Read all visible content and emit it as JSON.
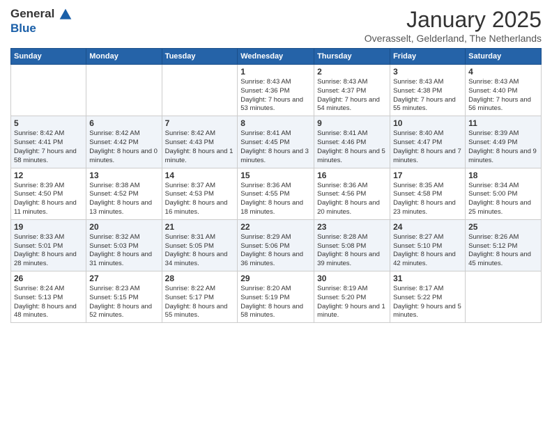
{
  "header": {
    "logo_general": "General",
    "logo_blue": "Blue",
    "month_title": "January 2025",
    "location": "Overasselt, Gelderland, The Netherlands"
  },
  "days_of_week": [
    "Sunday",
    "Monday",
    "Tuesday",
    "Wednesday",
    "Thursday",
    "Friday",
    "Saturday"
  ],
  "weeks": [
    [
      {
        "day": "",
        "info": ""
      },
      {
        "day": "",
        "info": ""
      },
      {
        "day": "",
        "info": ""
      },
      {
        "day": "1",
        "info": "Sunrise: 8:43 AM\nSunset: 4:36 PM\nDaylight: 7 hours and 53 minutes."
      },
      {
        "day": "2",
        "info": "Sunrise: 8:43 AM\nSunset: 4:37 PM\nDaylight: 7 hours and 54 minutes."
      },
      {
        "day": "3",
        "info": "Sunrise: 8:43 AM\nSunset: 4:38 PM\nDaylight: 7 hours and 55 minutes."
      },
      {
        "day": "4",
        "info": "Sunrise: 8:43 AM\nSunset: 4:40 PM\nDaylight: 7 hours and 56 minutes."
      }
    ],
    [
      {
        "day": "5",
        "info": "Sunrise: 8:42 AM\nSunset: 4:41 PM\nDaylight: 7 hours and 58 minutes."
      },
      {
        "day": "6",
        "info": "Sunrise: 8:42 AM\nSunset: 4:42 PM\nDaylight: 8 hours and 0 minutes."
      },
      {
        "day": "7",
        "info": "Sunrise: 8:42 AM\nSunset: 4:43 PM\nDaylight: 8 hours and 1 minute."
      },
      {
        "day": "8",
        "info": "Sunrise: 8:41 AM\nSunset: 4:45 PM\nDaylight: 8 hours and 3 minutes."
      },
      {
        "day": "9",
        "info": "Sunrise: 8:41 AM\nSunset: 4:46 PM\nDaylight: 8 hours and 5 minutes."
      },
      {
        "day": "10",
        "info": "Sunrise: 8:40 AM\nSunset: 4:47 PM\nDaylight: 8 hours and 7 minutes."
      },
      {
        "day": "11",
        "info": "Sunrise: 8:39 AM\nSunset: 4:49 PM\nDaylight: 8 hours and 9 minutes."
      }
    ],
    [
      {
        "day": "12",
        "info": "Sunrise: 8:39 AM\nSunset: 4:50 PM\nDaylight: 8 hours and 11 minutes."
      },
      {
        "day": "13",
        "info": "Sunrise: 8:38 AM\nSunset: 4:52 PM\nDaylight: 8 hours and 13 minutes."
      },
      {
        "day": "14",
        "info": "Sunrise: 8:37 AM\nSunset: 4:53 PM\nDaylight: 8 hours and 16 minutes."
      },
      {
        "day": "15",
        "info": "Sunrise: 8:36 AM\nSunset: 4:55 PM\nDaylight: 8 hours and 18 minutes."
      },
      {
        "day": "16",
        "info": "Sunrise: 8:36 AM\nSunset: 4:56 PM\nDaylight: 8 hours and 20 minutes."
      },
      {
        "day": "17",
        "info": "Sunrise: 8:35 AM\nSunset: 4:58 PM\nDaylight: 8 hours and 23 minutes."
      },
      {
        "day": "18",
        "info": "Sunrise: 8:34 AM\nSunset: 5:00 PM\nDaylight: 8 hours and 25 minutes."
      }
    ],
    [
      {
        "day": "19",
        "info": "Sunrise: 8:33 AM\nSunset: 5:01 PM\nDaylight: 8 hours and 28 minutes."
      },
      {
        "day": "20",
        "info": "Sunrise: 8:32 AM\nSunset: 5:03 PM\nDaylight: 8 hours and 31 minutes."
      },
      {
        "day": "21",
        "info": "Sunrise: 8:31 AM\nSunset: 5:05 PM\nDaylight: 8 hours and 34 minutes."
      },
      {
        "day": "22",
        "info": "Sunrise: 8:29 AM\nSunset: 5:06 PM\nDaylight: 8 hours and 36 minutes."
      },
      {
        "day": "23",
        "info": "Sunrise: 8:28 AM\nSunset: 5:08 PM\nDaylight: 8 hours and 39 minutes."
      },
      {
        "day": "24",
        "info": "Sunrise: 8:27 AM\nSunset: 5:10 PM\nDaylight: 8 hours and 42 minutes."
      },
      {
        "day": "25",
        "info": "Sunrise: 8:26 AM\nSunset: 5:12 PM\nDaylight: 8 hours and 45 minutes."
      }
    ],
    [
      {
        "day": "26",
        "info": "Sunrise: 8:24 AM\nSunset: 5:13 PM\nDaylight: 8 hours and 48 minutes."
      },
      {
        "day": "27",
        "info": "Sunrise: 8:23 AM\nSunset: 5:15 PM\nDaylight: 8 hours and 52 minutes."
      },
      {
        "day": "28",
        "info": "Sunrise: 8:22 AM\nSunset: 5:17 PM\nDaylight: 8 hours and 55 minutes."
      },
      {
        "day": "29",
        "info": "Sunrise: 8:20 AM\nSunset: 5:19 PM\nDaylight: 8 hours and 58 minutes."
      },
      {
        "day": "30",
        "info": "Sunrise: 8:19 AM\nSunset: 5:20 PM\nDaylight: 9 hours and 1 minute."
      },
      {
        "day": "31",
        "info": "Sunrise: 8:17 AM\nSunset: 5:22 PM\nDaylight: 9 hours and 5 minutes."
      },
      {
        "day": "",
        "info": ""
      }
    ]
  ]
}
